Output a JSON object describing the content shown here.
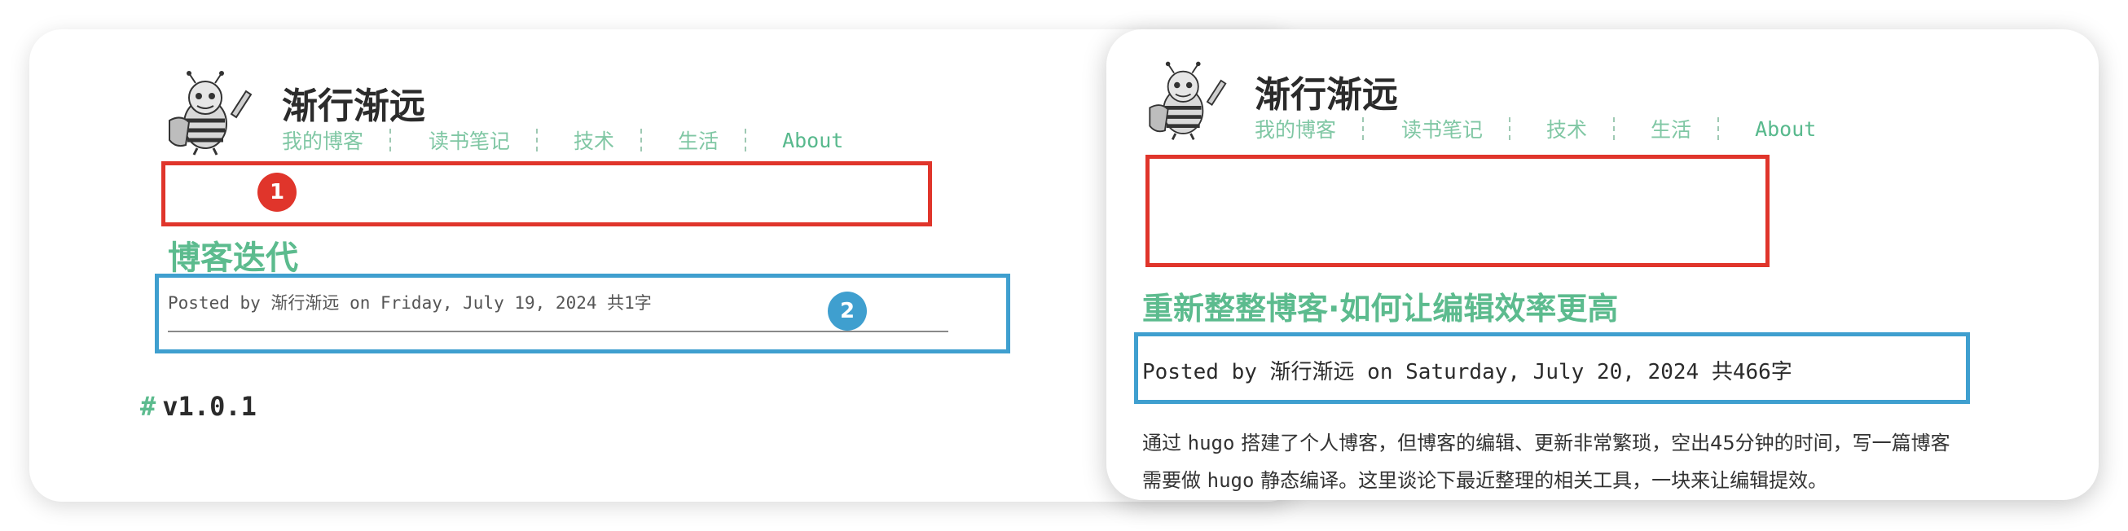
{
  "left_panel": {
    "site_title": "渐行渐远",
    "nav": [
      "我的博客",
      "读书笔记",
      "技术",
      "生活",
      "About"
    ],
    "badge_1": "1",
    "badge_2": "2",
    "post_title": "博客迭代",
    "meta": "Posted by 渐行渐远 on Friday, July 19, 2024 共1字",
    "heading_hash": "#",
    "heading": "v1.0.1"
  },
  "right_panel": {
    "site_title": "渐行渐远",
    "nav": [
      "我的博客",
      "读书笔记",
      "技术",
      "生活",
      "About"
    ],
    "post_title": "重新整整博客·如何让编辑效率更高",
    "meta": "Posted by 渐行渐远 on Saturday, July 20, 2024 共466字",
    "body_line1_a": "通过 ",
    "body_line1_b": "hugo",
    "body_line1_c": " 搭建了个人博客，但博客的编辑、更新非常繁琐，空出45分钟的时间，写一篇博客",
    "body_line2_a": "需要做 ",
    "body_line2_b": "hugo",
    "body_line2_c": " 静态编译。这里谈论下最近整理的相关工具，一块来让编辑提效。"
  },
  "colors": {
    "accent_green": "#5cbb8e",
    "nav_green": "#80c7a4",
    "annotation_red": "#e0352b",
    "annotation_blue": "#3f9fcf"
  },
  "icons": {
    "logo": "bee-mascot-icon"
  }
}
